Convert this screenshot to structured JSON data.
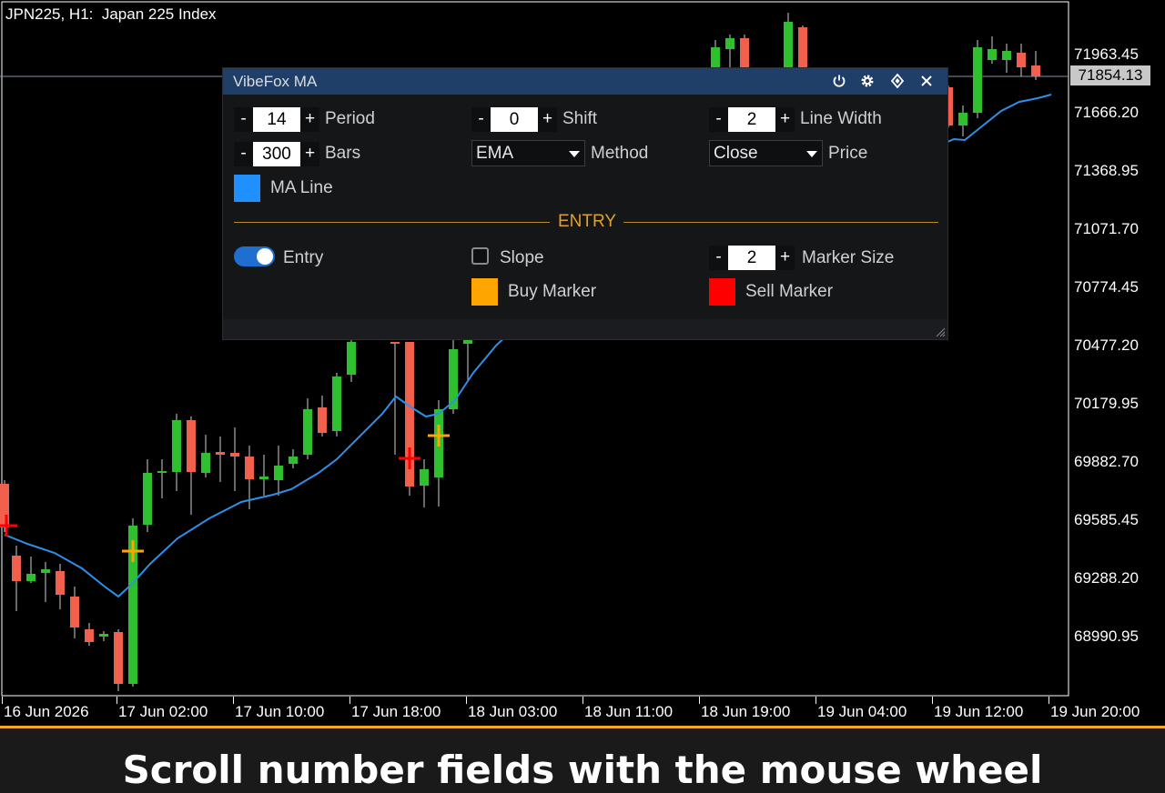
{
  "chart": {
    "title": "JPN225, H1:  Japan 225 Index",
    "current_price": "71854.13",
    "price_labels": [
      "71963.45",
      "71666.20",
      "71368.95",
      "71071.70",
      "70774.45",
      "70477.20",
      "70179.95",
      "69882.70",
      "69585.45",
      "69288.20",
      "68990.95"
    ],
    "time_labels": [
      "16 Jun 2026",
      "17 Jun 02:00",
      "17 Jun 10:00",
      "17 Jun 18:00",
      "18 Jun 03:00",
      "18 Jun 11:00",
      "18 Jun 19:00",
      "19 Jun 04:00",
      "19 Jun 12:00",
      "19 Jun 20:00"
    ],
    "colors": {
      "bull": "#2fbf2f",
      "bear": "#f0604c",
      "ma_line": "#2f8fe8",
      "buy_marker": "#ffa500",
      "sell_marker": "#ff0000"
    }
  },
  "panel": {
    "title": "VibeFox MA",
    "header_icons": [
      "power-icon",
      "gear-icon",
      "diamond-arrows-icon",
      "close-icon"
    ],
    "period": {
      "label": "Period",
      "value": "14",
      "minus": "-",
      "plus": "+"
    },
    "shift": {
      "label": "Shift",
      "value": "0",
      "minus": "-",
      "plus": "+"
    },
    "line_width": {
      "label": "Line Width",
      "value": "2",
      "minus": "-",
      "plus": "+"
    },
    "bars": {
      "label": "Bars",
      "value": "300",
      "minus": "-",
      "plus": "+"
    },
    "method": {
      "label": "Method",
      "value": "EMA"
    },
    "price": {
      "label": "Price",
      "value": "Close"
    },
    "ma_line": {
      "label": "MA Line",
      "color": "#1e90ff"
    },
    "entry_section": "ENTRY",
    "entry": {
      "label": "Entry",
      "on": true
    },
    "slope": {
      "label": "Slope",
      "checked": false
    },
    "marker_size": {
      "label": "Marker Size",
      "value": "2",
      "minus": "-",
      "plus": "+"
    },
    "buy_marker": {
      "label": "Buy Marker",
      "color": "#ffa500"
    },
    "sell_marker": {
      "label": "Sell Marker",
      "color": "#ff0000"
    }
  },
  "banner": {
    "text": "Scroll number fields with the mouse wheel"
  }
}
